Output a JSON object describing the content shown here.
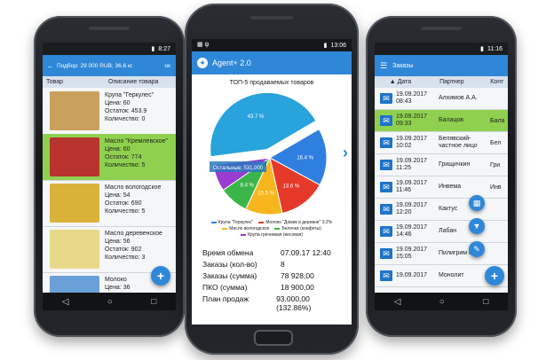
{
  "phone1": {
    "status_time": "8:27",
    "appbar_title": "Подбор: 29 000 RUB; 36.6 кг.",
    "appbar_ok": "ок",
    "col_product": "Товар",
    "col_desc": "Описание товара",
    "items": [
      {
        "name": "Крупа \"Геркулес\"",
        "price": "Цена: 60",
        "stock": "Остаток: 453.9",
        "qty": "Количество: 0",
        "selected": false,
        "img_color": "#c9a15c"
      },
      {
        "name": "Масло \"Кремлевское\"",
        "price": "Цена: 60",
        "stock": "Остаток: 774",
        "qty": "Количество: 5",
        "selected": true,
        "img_color": "#b8332e"
      },
      {
        "name": "Масло вологодское",
        "price": "Цена: 54",
        "stock": "Остаток: 690",
        "qty": "Количество: 5",
        "selected": false,
        "img_color": "#d9b23a"
      },
      {
        "name": "Масло деревенское",
        "price": "Цена: 56",
        "stock": "Остаток: 902",
        "qty": "Количество: 3",
        "selected": false,
        "img_color": "#e8d98a"
      },
      {
        "name": "Молоко",
        "price": "Цена: 36",
        "stock": "",
        "qty": "",
        "selected": false,
        "img_color": "#6aa0d8"
      }
    ],
    "fab_icon": "+"
  },
  "phone2": {
    "status_time": "13:06",
    "app_title": "Agent+ 2.0",
    "chart_title": "ТОП-5 продаваемых товаров",
    "next_icon": "›",
    "stats": [
      {
        "label": "Время обмена",
        "value": "07.09.17 12:40"
      },
      {
        "label": "Заказы (кол-во)",
        "value": "8"
      },
      {
        "label": "Заказы (сумма)",
        "value": "78 928,00"
      },
      {
        "label": "ПКО (сумма)",
        "value": "18 900,00"
      },
      {
        "label": "План продаж",
        "value": "93,000,00 (132.86%)"
      }
    ]
  },
  "chart_data": {
    "type": "pie",
    "title": "ТОП-5 продаваемых товаров",
    "slices": [
      {
        "label": "Остальные",
        "value": 43.7,
        "color": "#29a3dc",
        "text": "43.7 %"
      },
      {
        "label": "Крупа \"Геркулес\"",
        "value": 16.4,
        "color": "#2f7fe0",
        "text": "16.4 %"
      },
      {
        "label": "Молоко \"Домик в деревне\" 3.2%",
        "value": 13.6,
        "color": "#e53a2a",
        "text": "13.6 %"
      },
      {
        "label": "Масло вологодское",
        "value": 10.5,
        "color": "#f7b51e",
        "text": "10.5 %"
      },
      {
        "label": "Белочка (конфеты)",
        "value": 8.4,
        "color": "#3ab54a",
        "text": "8.4 %"
      },
      {
        "label": "Крупа гречневая (весовая)",
        "value": 7.6,
        "color": "#9b3bd0",
        "text": "7.6 %"
      }
    ],
    "callout": "Остальные: 531.000"
  },
  "phone3": {
    "status_time": "11:16",
    "appbar_title": "Заказы",
    "col_date": "Дата",
    "col_partner": "Партнер",
    "col_extra": "Конт",
    "rows": [
      {
        "date1": "19.09.2017",
        "date2": "08:43",
        "partner": "Алхимов А.А.",
        "extra": "",
        "selected": false,
        "icon_color": "#1e74c9"
      },
      {
        "date1": "19.09.2017",
        "date2": "09:33",
        "partner": "Балацов",
        "extra": "Бала",
        "selected": true,
        "icon_color": "#1e74c9"
      },
      {
        "date1": "19.09.2017",
        "date2": "10:02",
        "partner": "Белявский-частное лицо",
        "extra": "Бел",
        "selected": false,
        "icon_color": "#1e74c9"
      },
      {
        "date1": "19.09.2017",
        "date2": "11:25",
        "partner": "Грищичкин",
        "extra": "Гри",
        "selected": false,
        "icon_color": "#1e74c9"
      },
      {
        "date1": "19.09.2017",
        "date2": "11:46",
        "partner": "Инвема",
        "extra": "Инв",
        "selected": false,
        "icon_color": "#1e74c9"
      },
      {
        "date1": "19.09.2017",
        "date2": "12:20",
        "partner": "Кактус",
        "extra": "",
        "selected": false,
        "icon_color": "#1e74c9"
      },
      {
        "date1": "19.09.2017",
        "date2": "14:46",
        "partner": "Лабан",
        "extra": "",
        "selected": false,
        "icon_color": "#1e74c9"
      },
      {
        "date1": "19.09.2017",
        "date2": "15:05",
        "partner": "Пилигрим ООО",
        "extra": "",
        "selected": false,
        "icon_color": "#1e74c9"
      },
      {
        "date1": "19.09.2017",
        "date2": "",
        "partner": "Монолит",
        "extra": "",
        "selected": false,
        "icon_color": "#1e74c9"
      }
    ],
    "fab_icons": [
      "grid-icon",
      "filter-icon",
      "edit-icon",
      "add-icon"
    ]
  }
}
